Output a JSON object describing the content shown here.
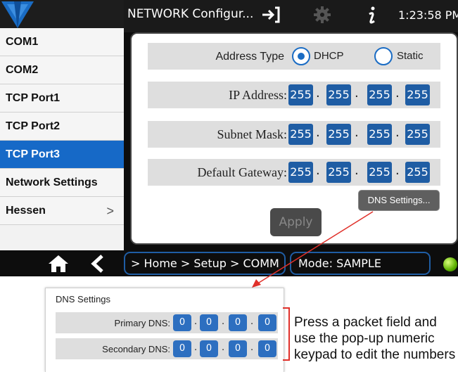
{
  "header": {
    "title": "NETWORK Configur...",
    "time": "1:23:58 PM"
  },
  "sidebar": {
    "items": [
      {
        "label": "COM1"
      },
      {
        "label": "COM2"
      },
      {
        "label": "TCP Port1"
      },
      {
        "label": "TCP Port2"
      },
      {
        "label": "TCP Port3",
        "active": true
      },
      {
        "label": "Network Settings"
      },
      {
        "label": "Hessen",
        "submenu": ">"
      }
    ]
  },
  "form": {
    "address_type_label": "Address Type",
    "dhcp_label": "DHCP",
    "static_label": "Static",
    "selected": "DHCP",
    "ip_label": "IP Address:",
    "ip": [
      "255",
      "255",
      "255",
      "255"
    ],
    "subnet_label": "Subnet Mask:",
    "subnet": [
      "255",
      "255",
      "255",
      "255"
    ],
    "gateway_label": "Default Gateway:",
    "gateway": [
      "255",
      "255",
      "255",
      "255"
    ],
    "separator": ".",
    "dns_button": "DNS Settings...",
    "apply_button": "Apply"
  },
  "footer": {
    "breadcrumb": "> Home > Setup > COMM",
    "mode": "Mode: SAMPLE",
    "status_color": "#5cb000"
  },
  "popup": {
    "title": "DNS Settings",
    "primary_label": "Primary DNS:",
    "primary": [
      "0",
      "0",
      "0",
      "0"
    ],
    "secondary_label": "Secondary DNS:",
    "secondary": [
      "0",
      "0",
      "0",
      "0"
    ]
  },
  "annotation": {
    "lines": [
      "Press a packet field and",
      "use the pop-up numeric",
      "keypad to edit the numbers"
    ],
    "color": "#e0302a"
  },
  "colors": {
    "accent": "#1669c7",
    "octet": "#1f5da4"
  },
  "icons": [
    "logo",
    "exit-icon",
    "gear-icon",
    "info-icon",
    "home-icon",
    "back-icon"
  ]
}
